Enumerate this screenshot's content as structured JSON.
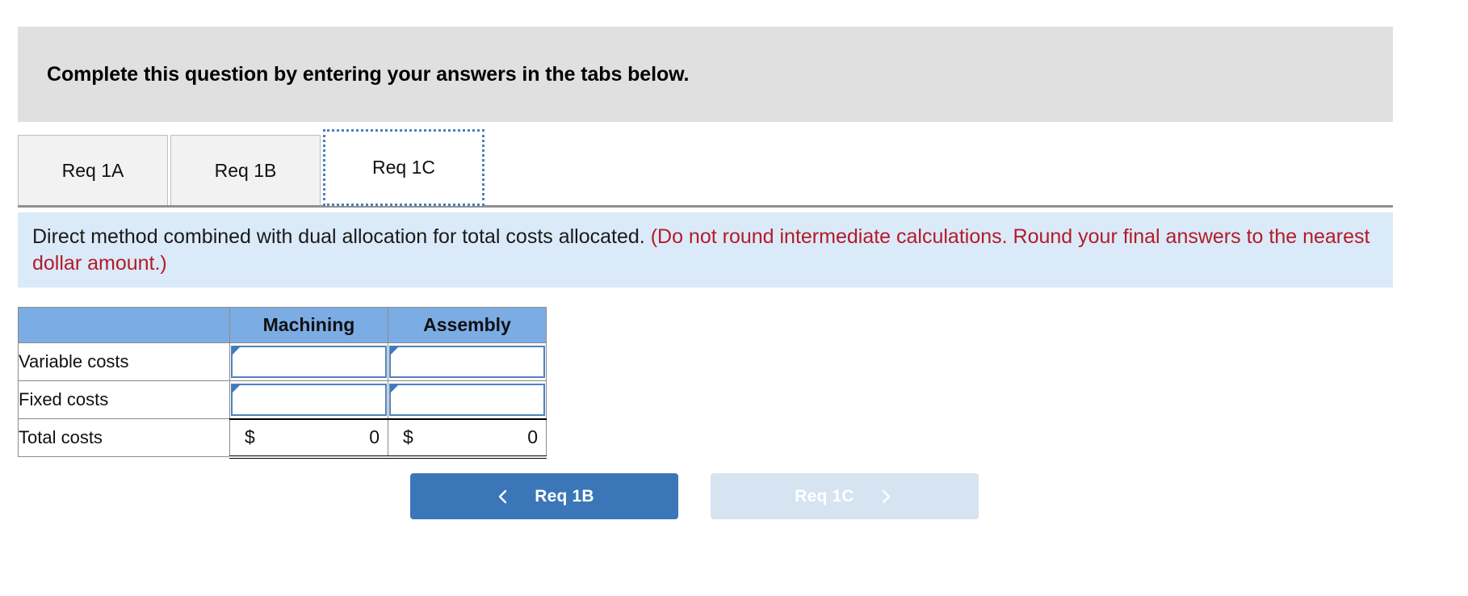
{
  "header": {
    "instruction": "Complete this question by entering your answers in the tabs below."
  },
  "tabs": {
    "items": [
      {
        "label": "Req 1A",
        "active": false
      },
      {
        "label": "Req 1B",
        "active": false
      },
      {
        "label": "Req 1C",
        "active": true
      }
    ]
  },
  "requirement": {
    "text": "Direct method combined with dual allocation for total costs allocated. ",
    "note": "(Do not round intermediate calculations. Round your final answers to the nearest dollar amount.)"
  },
  "table": {
    "corner_label": "",
    "columns": [
      "Machining",
      "Assembly"
    ],
    "rows": [
      {
        "label": "Variable costs",
        "type": "input",
        "values": [
          "",
          ""
        ]
      },
      {
        "label": "Fixed costs",
        "type": "input",
        "values": [
          "",
          ""
        ]
      },
      {
        "label": "Total costs",
        "type": "total",
        "currency": [
          "$",
          "$"
        ],
        "values": [
          "0",
          "0"
        ]
      }
    ]
  },
  "navigation": {
    "prev_label": "Req 1B",
    "next_label": "Req 1C",
    "prev_icon": "chevron-left-icon",
    "next_icon": "chevron-right-icon",
    "next_disabled": true
  },
  "colors": {
    "header_gray": "#e0e0e0",
    "banner_blue": "#daeaf8",
    "note_red": "#b51a28",
    "table_header_blue": "#7cace4",
    "input_border_blue": "#4f82bd",
    "primary_button": "#3a76b8",
    "disabled_button": "#d6e3f0"
  }
}
